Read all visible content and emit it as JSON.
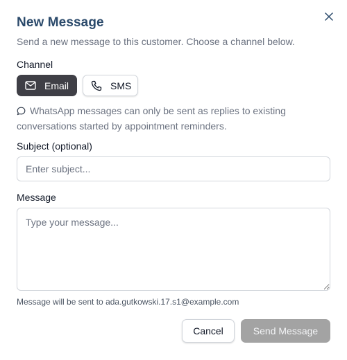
{
  "dialog": {
    "title": "New Message",
    "subtitle": "Send a new message to this customer. Choose a channel below.",
    "close_icon": "close-icon"
  },
  "channel": {
    "label": "Channel",
    "options": [
      {
        "label": "Email",
        "icon": "mail-icon",
        "selected": true
      },
      {
        "label": "SMS",
        "icon": "phone-icon",
        "selected": false
      }
    ],
    "note": "WhatsApp messages can only be sent as replies to existing conversations started by appointment reminders.",
    "note_icon": "chat-bubble-icon"
  },
  "subject": {
    "label": "Subject (optional)",
    "placeholder": "Enter subject...",
    "value": ""
  },
  "message": {
    "label": "Message",
    "placeholder": "Type your message...",
    "value": "",
    "hint": "Message will be sent to ada.gutkowski.17.s1@example.com"
  },
  "actions": {
    "cancel_label": "Cancel",
    "send_label": "Send Message",
    "send_disabled": true
  },
  "colors": {
    "title": "#2b4a6b",
    "selected_channel_bg": "#3f3f46",
    "send_disabled_bg": "#a3a3a3"
  }
}
